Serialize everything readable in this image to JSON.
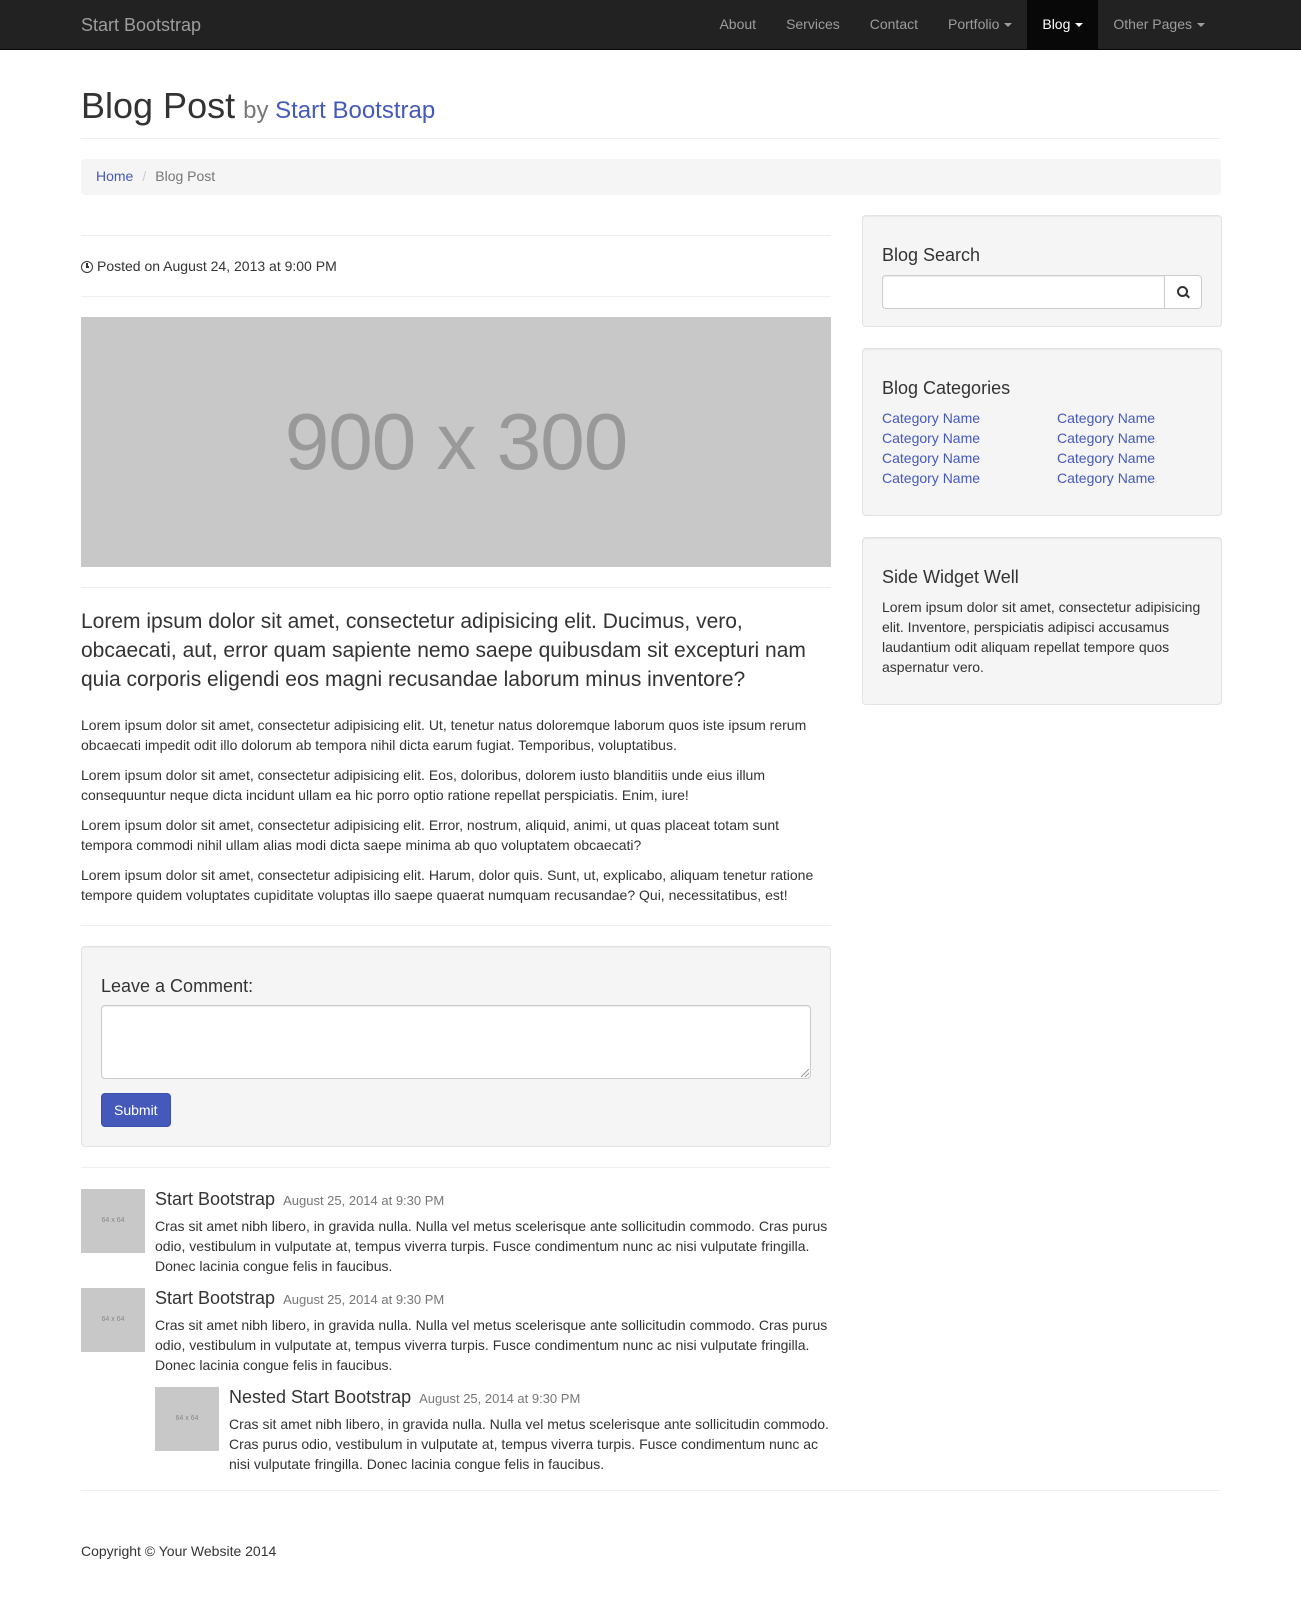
{
  "navbar": {
    "brand": "Start Bootstrap",
    "items": [
      {
        "label": "About"
      },
      {
        "label": "Services"
      },
      {
        "label": "Contact"
      },
      {
        "label": "Portfolio"
      },
      {
        "label": "Blog"
      },
      {
        "label": "Other Pages"
      }
    ]
  },
  "header": {
    "title": "Blog Post",
    "by": "by",
    "author": "Start Bootstrap"
  },
  "breadcrumb": {
    "home": "Home",
    "sep": "/",
    "current": "Blog Post"
  },
  "post": {
    "posted": "Posted on August 24, 2013 at 9:00 PM",
    "image_label": "900 x 300",
    "lead": "Lorem ipsum dolor sit amet, consectetur adipisicing elit. Ducimus, vero, obcaecati, aut, error quam sapiente nemo saepe quibusdam sit excepturi nam quia corporis eligendi eos magni recusandae laborum minus inventore?",
    "paragraphs": [
      "Lorem ipsum dolor sit amet, consectetur adipisicing elit. Ut, tenetur natus doloremque laborum quos iste ipsum rerum obcaecati impedit odit illo dolorum ab tempora nihil dicta earum fugiat. Temporibus, voluptatibus.",
      "Lorem ipsum dolor sit amet, consectetur adipisicing elit. Eos, doloribus, dolorem iusto blanditiis unde eius illum consequuntur neque dicta incidunt ullam ea hic porro optio ratione repellat perspiciatis. Enim, iure!",
      "Lorem ipsum dolor sit amet, consectetur adipisicing elit. Error, nostrum, aliquid, animi, ut quas placeat totam sunt tempora commodi nihil ullam alias modi dicta saepe minima ab quo voluptatem obcaecati?",
      "Lorem ipsum dolor sit amet, consectetur adipisicing elit. Harum, dolor quis. Sunt, ut, explicabo, aliquam tenetur ratione tempore quidem voluptates cupiditate voluptas illo saepe quaerat numquam recusandae? Qui, necessitatibus, est!"
    ]
  },
  "comment_form": {
    "heading": "Leave a Comment:",
    "value": "",
    "submit": "Submit"
  },
  "comments": [
    {
      "avatar": "64 x 64",
      "author": "Start Bootstrap",
      "date": "August 25, 2014 at 9:30 PM",
      "text": "Cras sit amet nibh libero, in gravida nulla. Nulla vel metus scelerisque ante sollicitudin commodo. Cras purus odio, vestibulum in vulputate at, tempus viverra turpis. Fusce condimentum nunc ac nisi vulputate fringilla. Donec lacinia congue felis in faucibus."
    },
    {
      "avatar": "64 x 64",
      "author": "Start Bootstrap",
      "date": "August 25, 2014 at 9:30 PM",
      "text": "Cras sit amet nibh libero, in gravida nulla. Nulla vel metus scelerisque ante sollicitudin commodo. Cras purus odio, vestibulum in vulputate at, tempus viverra turpis. Fusce condimentum nunc ac nisi vulputate fringilla. Donec lacinia congue felis in faucibus."
    },
    {
      "avatar": "64 x 64",
      "author": "Nested Start Bootstrap",
      "date": "August 25, 2014 at 9:30 PM",
      "text": "Cras sit amet nibh libero, in gravida nulla. Nulla vel metus scelerisque ante sollicitudin commodo. Cras purus odio, vestibulum in vulputate at, tempus viverra turpis. Fusce condimentum nunc ac nisi vulputate fringilla. Donec lacinia congue felis in faucibus."
    }
  ],
  "sidebar": {
    "search": {
      "heading": "Blog Search",
      "value": "",
      "icon": "search-icon"
    },
    "categories": {
      "heading": "Blog Categories",
      "items": [
        "Category Name",
        "Category Name",
        "Category Name",
        "Category Name",
        "Category Name",
        "Category Name",
        "Category Name",
        "Category Name"
      ]
    },
    "widget": {
      "heading": "Side Widget Well",
      "text": "Lorem ipsum dolor sit amet, consectetur adipisicing elit. Inventore, perspiciatis adipisci accusamus laudantium odit aliquam repellat tempore quos aspernatur vero."
    }
  },
  "footer": {
    "copyright": "Copyright © Your Website 2014"
  },
  "colors": {
    "navbar": "#222222",
    "link": "#4559bb",
    "primary_button": "#4559bb",
    "well": "#f5f5f5",
    "placeholder_image": "#c8c8c8"
  }
}
